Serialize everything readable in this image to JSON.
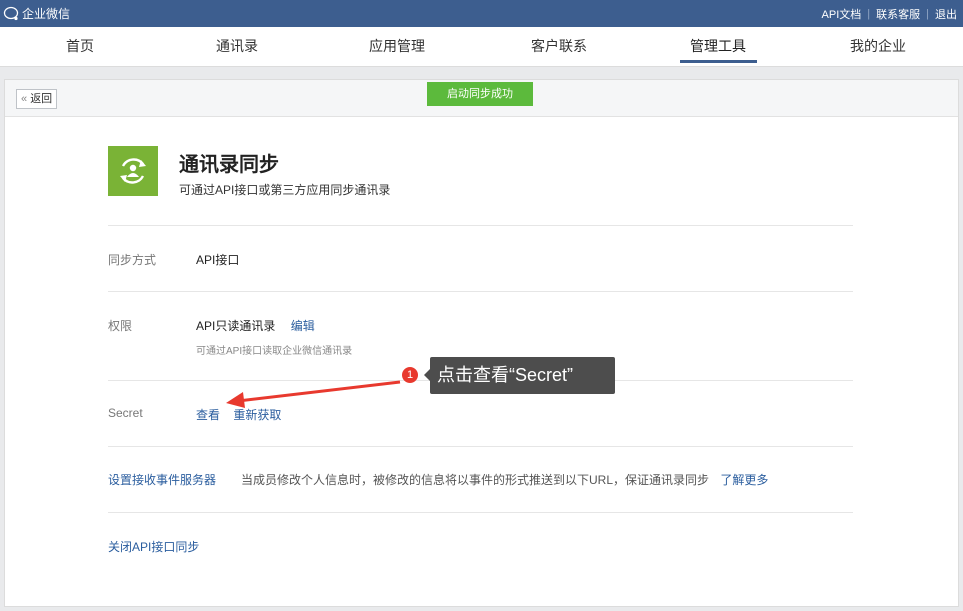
{
  "topbar": {
    "logo_text": "企业微信",
    "links": [
      "API文档",
      "联系客服",
      "退出"
    ]
  },
  "nav": {
    "items": [
      "首页",
      "通讯录",
      "应用管理",
      "客户联系",
      "管理工具",
      "我的企业"
    ],
    "active_index": 4
  },
  "panel": {
    "back_label": "返回",
    "toast": "启动同步成功",
    "app_title": "通讯录同步",
    "app_subtitle": "可通过API接口或第三方应用同步通讯录",
    "sync_method": {
      "label": "同步方式",
      "value": "API接口"
    },
    "permission": {
      "label": "权限",
      "value": "API只读通讯录",
      "edit_link": "编辑",
      "note": "可通过API接口读取企业微信通讯录"
    },
    "secret": {
      "label": "Secret",
      "view_link": "查看",
      "refresh_link": "重新获取"
    },
    "event_server": {
      "label": "设置接收事件服务器",
      "desc": "当成员修改个人信息时，被修改的信息将以事件的形式推送到以下URL，保证通讯录同步",
      "more_link": "了解更多"
    },
    "close_sync": "关闭API接口同步"
  },
  "annotation": {
    "badge": "1",
    "tooltip": "点击查看“Secret”",
    "color": "#e8392e"
  },
  "colors": {
    "topbar": "#3d5e8f",
    "toast": "#5cba3c",
    "app_icon": "#7ab336",
    "link": "#2a5d9e"
  }
}
